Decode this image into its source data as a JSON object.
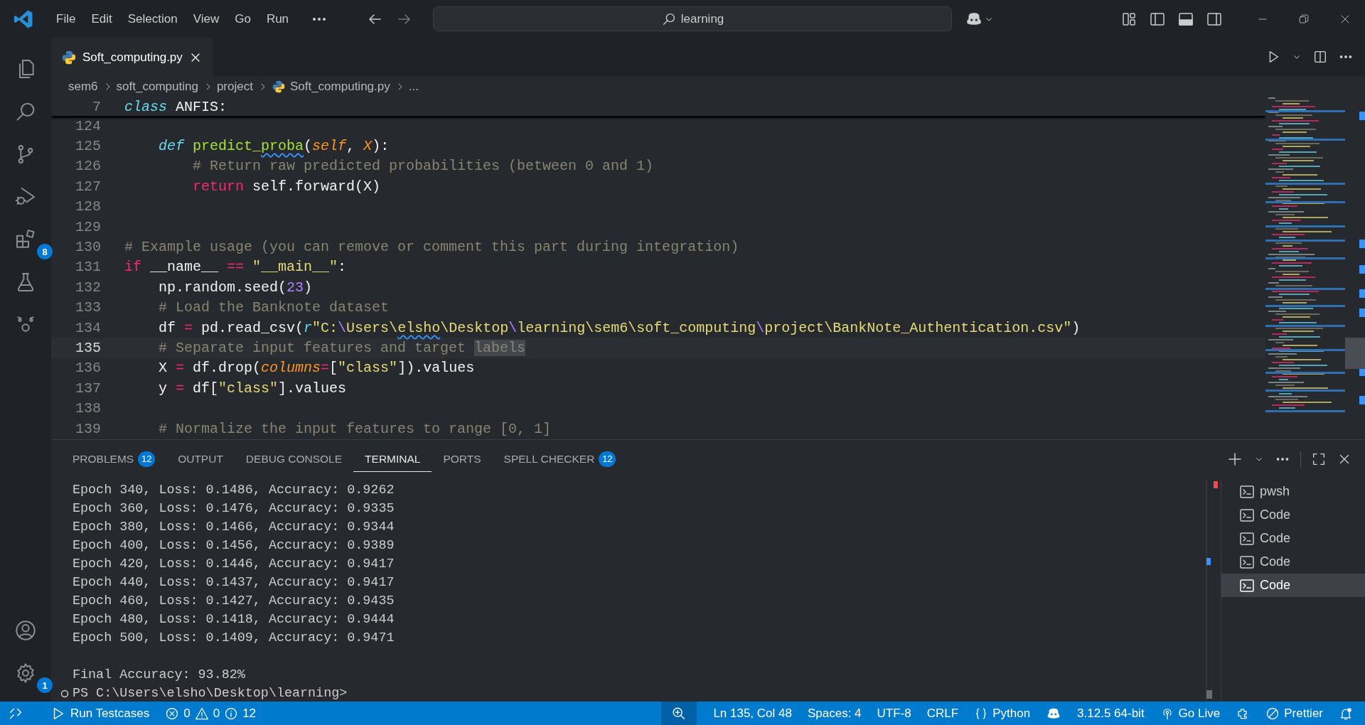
{
  "title_bar": {
    "menus": [
      "File",
      "Edit",
      "Selection",
      "View",
      "Go",
      "Run"
    ],
    "search": "learning"
  },
  "activity_bar": {
    "extensions_badge": "8",
    "settings_badge": "1"
  },
  "editor": {
    "tab": {
      "label": "Soft_computing.py"
    },
    "breadcrumb": [
      {
        "label": "sem6",
        "kind": "folder"
      },
      {
        "label": "soft_computing",
        "kind": "folder"
      },
      {
        "label": "project",
        "kind": "folder"
      },
      {
        "label": "Soft_computing.py",
        "kind": "file"
      },
      {
        "label": "...",
        "kind": "more"
      }
    ],
    "sticky": {
      "number": "7",
      "tokens": [
        {
          "text": "class",
          "kind": "storage"
        },
        {
          "text": " ANFIS:",
          "kind": "plain"
        }
      ]
    },
    "lines": [
      {
        "number": "124",
        "current": false
      },
      {
        "number": "125",
        "current": false,
        "tokens": [
          {
            "text": "    def",
            "kind": "storage"
          },
          {
            "text": " predict_",
            "kind": "func"
          },
          {
            "text": "proba",
            "kind": "func",
            "squiggle": true
          },
          {
            "text": "(",
            "kind": "plain"
          },
          {
            "text": "self",
            "kind": "param"
          },
          {
            "text": ", ",
            "kind": "plain"
          },
          {
            "text": "X",
            "kind": "param"
          },
          {
            "text": "):",
            "kind": "plain"
          }
        ]
      },
      {
        "number": "126",
        "current": false,
        "tokens": [
          {
            "text": "        # Return raw predicted probabilities (between 0 and 1)",
            "kind": "comment"
          }
        ]
      },
      {
        "number": "127",
        "current": false,
        "tokens": [
          {
            "text": "        return",
            "kind": "keyword"
          },
          {
            "text": " self.forward(X)",
            "kind": "plain"
          }
        ]
      },
      {
        "number": "128",
        "current": false
      },
      {
        "number": "129",
        "current": false
      },
      {
        "number": "130",
        "current": false,
        "tokens": [
          {
            "text": "# Example usage (you can remove or comment this part during integration)",
            "kind": "comment"
          }
        ]
      },
      {
        "number": "131",
        "current": false,
        "tokens": [
          {
            "text": "if",
            "kind": "keyword"
          },
          {
            "text": " __name__ ",
            "kind": "plain"
          },
          {
            "text": "==",
            "kind": "keyword"
          },
          {
            "text": " \"__main__\"",
            "kind": "string"
          },
          {
            "text": ":",
            "kind": "plain"
          }
        ]
      },
      {
        "number": "132",
        "current": false,
        "tokens": [
          {
            "text": "    np.random.seed(",
            "kind": "plain"
          },
          {
            "text": "23",
            "kind": "number"
          },
          {
            "text": ")",
            "kind": "plain"
          }
        ]
      },
      {
        "number": "133",
        "current": false,
        "tokens": [
          {
            "text": "    # Load the Banknote dataset",
            "kind": "comment"
          }
        ]
      },
      {
        "number": "134",
        "current": false,
        "tokens": [
          {
            "text": "    df ",
            "kind": "plain"
          },
          {
            "text": "=",
            "kind": "keyword"
          },
          {
            "text": " pd.read_csv(",
            "kind": "plain"
          },
          {
            "text": "r",
            "kind": "storage"
          },
          {
            "text": "\"C:",
            "kind": "string"
          },
          {
            "text": "\\",
            "kind": "escape"
          },
          {
            "text": "Users\\",
            "kind": "string"
          },
          {
            "text": "elsho",
            "kind": "string",
            "squiggle": true
          },
          {
            "text": "\\Desktop",
            "kind": "string"
          },
          {
            "text": "\\",
            "kind": "escape"
          },
          {
            "text": "learning\\sem6\\soft_computing",
            "kind": "string"
          },
          {
            "text": "\\",
            "kind": "escape"
          },
          {
            "text": "project\\BankNote_Authentication.csv\"",
            "kind": "string"
          },
          {
            "text": ")",
            "kind": "plain"
          }
        ]
      },
      {
        "number": "135",
        "current": true,
        "tokens": [
          {
            "text": "    # Separate input features and target ",
            "kind": "comment"
          },
          {
            "text": "labels",
            "kind": "comment",
            "highlight": true
          }
        ]
      },
      {
        "number": "136",
        "current": false,
        "tokens": [
          {
            "text": "    X ",
            "kind": "plain"
          },
          {
            "text": "=",
            "kind": "keyword"
          },
          {
            "text": " df.drop(",
            "kind": "plain"
          },
          {
            "text": "columns",
            "kind": "param"
          },
          {
            "text": "=",
            "kind": "keyword"
          },
          {
            "text": "[",
            "kind": "plain"
          },
          {
            "text": "\"class\"",
            "kind": "string"
          },
          {
            "text": "]).values",
            "kind": "plain"
          }
        ]
      },
      {
        "number": "137",
        "current": false,
        "tokens": [
          {
            "text": "    y ",
            "kind": "plain"
          },
          {
            "text": "=",
            "kind": "keyword"
          },
          {
            "text": " df[",
            "kind": "plain"
          },
          {
            "text": "\"class\"",
            "kind": "string"
          },
          {
            "text": "].values",
            "kind": "plain"
          }
        ]
      },
      {
        "number": "138",
        "current": false
      },
      {
        "number": "139",
        "current": false,
        "tokens": [
          {
            "text": "    # Normalize the input features to range [0, 1]",
            "kind": "comment"
          }
        ]
      }
    ]
  },
  "panel": {
    "tabs": [
      {
        "label": "PROBLEMS",
        "badge": "12",
        "selected": false
      },
      {
        "label": "OUTPUT",
        "selected": false
      },
      {
        "label": "DEBUG CONSOLE",
        "selected": false
      },
      {
        "label": "TERMINAL",
        "selected": true
      },
      {
        "label": "PORTS",
        "selected": false
      },
      {
        "label": "SPELL CHECKER",
        "badge": "12",
        "selected": false
      }
    ],
    "output": [
      "Epoch 340, Loss: 0.1486, Accuracy: 0.9262",
      "Epoch 360, Loss: 0.1476, Accuracy: 0.9335",
      "Epoch 380, Loss: 0.1466, Accuracy: 0.9344",
      "Epoch 400, Loss: 0.1456, Accuracy: 0.9389",
      "Epoch 420, Loss: 0.1446, Accuracy: 0.9417",
      "Epoch 440, Loss: 0.1437, Accuracy: 0.9417",
      "Epoch 460, Loss: 0.1427, Accuracy: 0.9435",
      "Epoch 480, Loss: 0.1418, Accuracy: 0.9444",
      "Epoch 500, Loss: 0.1409, Accuracy: 0.9471"
    ],
    "result": "Final Accuracy: 93.82%",
    "prompt": "PS C:\\Users\\elsho\\Desktop\\learning>",
    "terminals": [
      {
        "label": "pwsh",
        "selected": false
      },
      {
        "label": "Code",
        "selected": false
      },
      {
        "label": "Code",
        "selected": false
      },
      {
        "label": "Code",
        "selected": false
      },
      {
        "label": "Code",
        "selected": true
      }
    ]
  },
  "status_bar": {
    "run": "Run Testcases",
    "errors": "0",
    "warnings": "0",
    "infos": "12",
    "position": "Ln 135, Col 48",
    "indent": "Spaces: 4",
    "encoding": "UTF-8",
    "eol": "CRLF",
    "language": "Python",
    "interpreter": "3.12.5 64-bit",
    "live": "Go Live",
    "formatter": "Prettier"
  }
}
